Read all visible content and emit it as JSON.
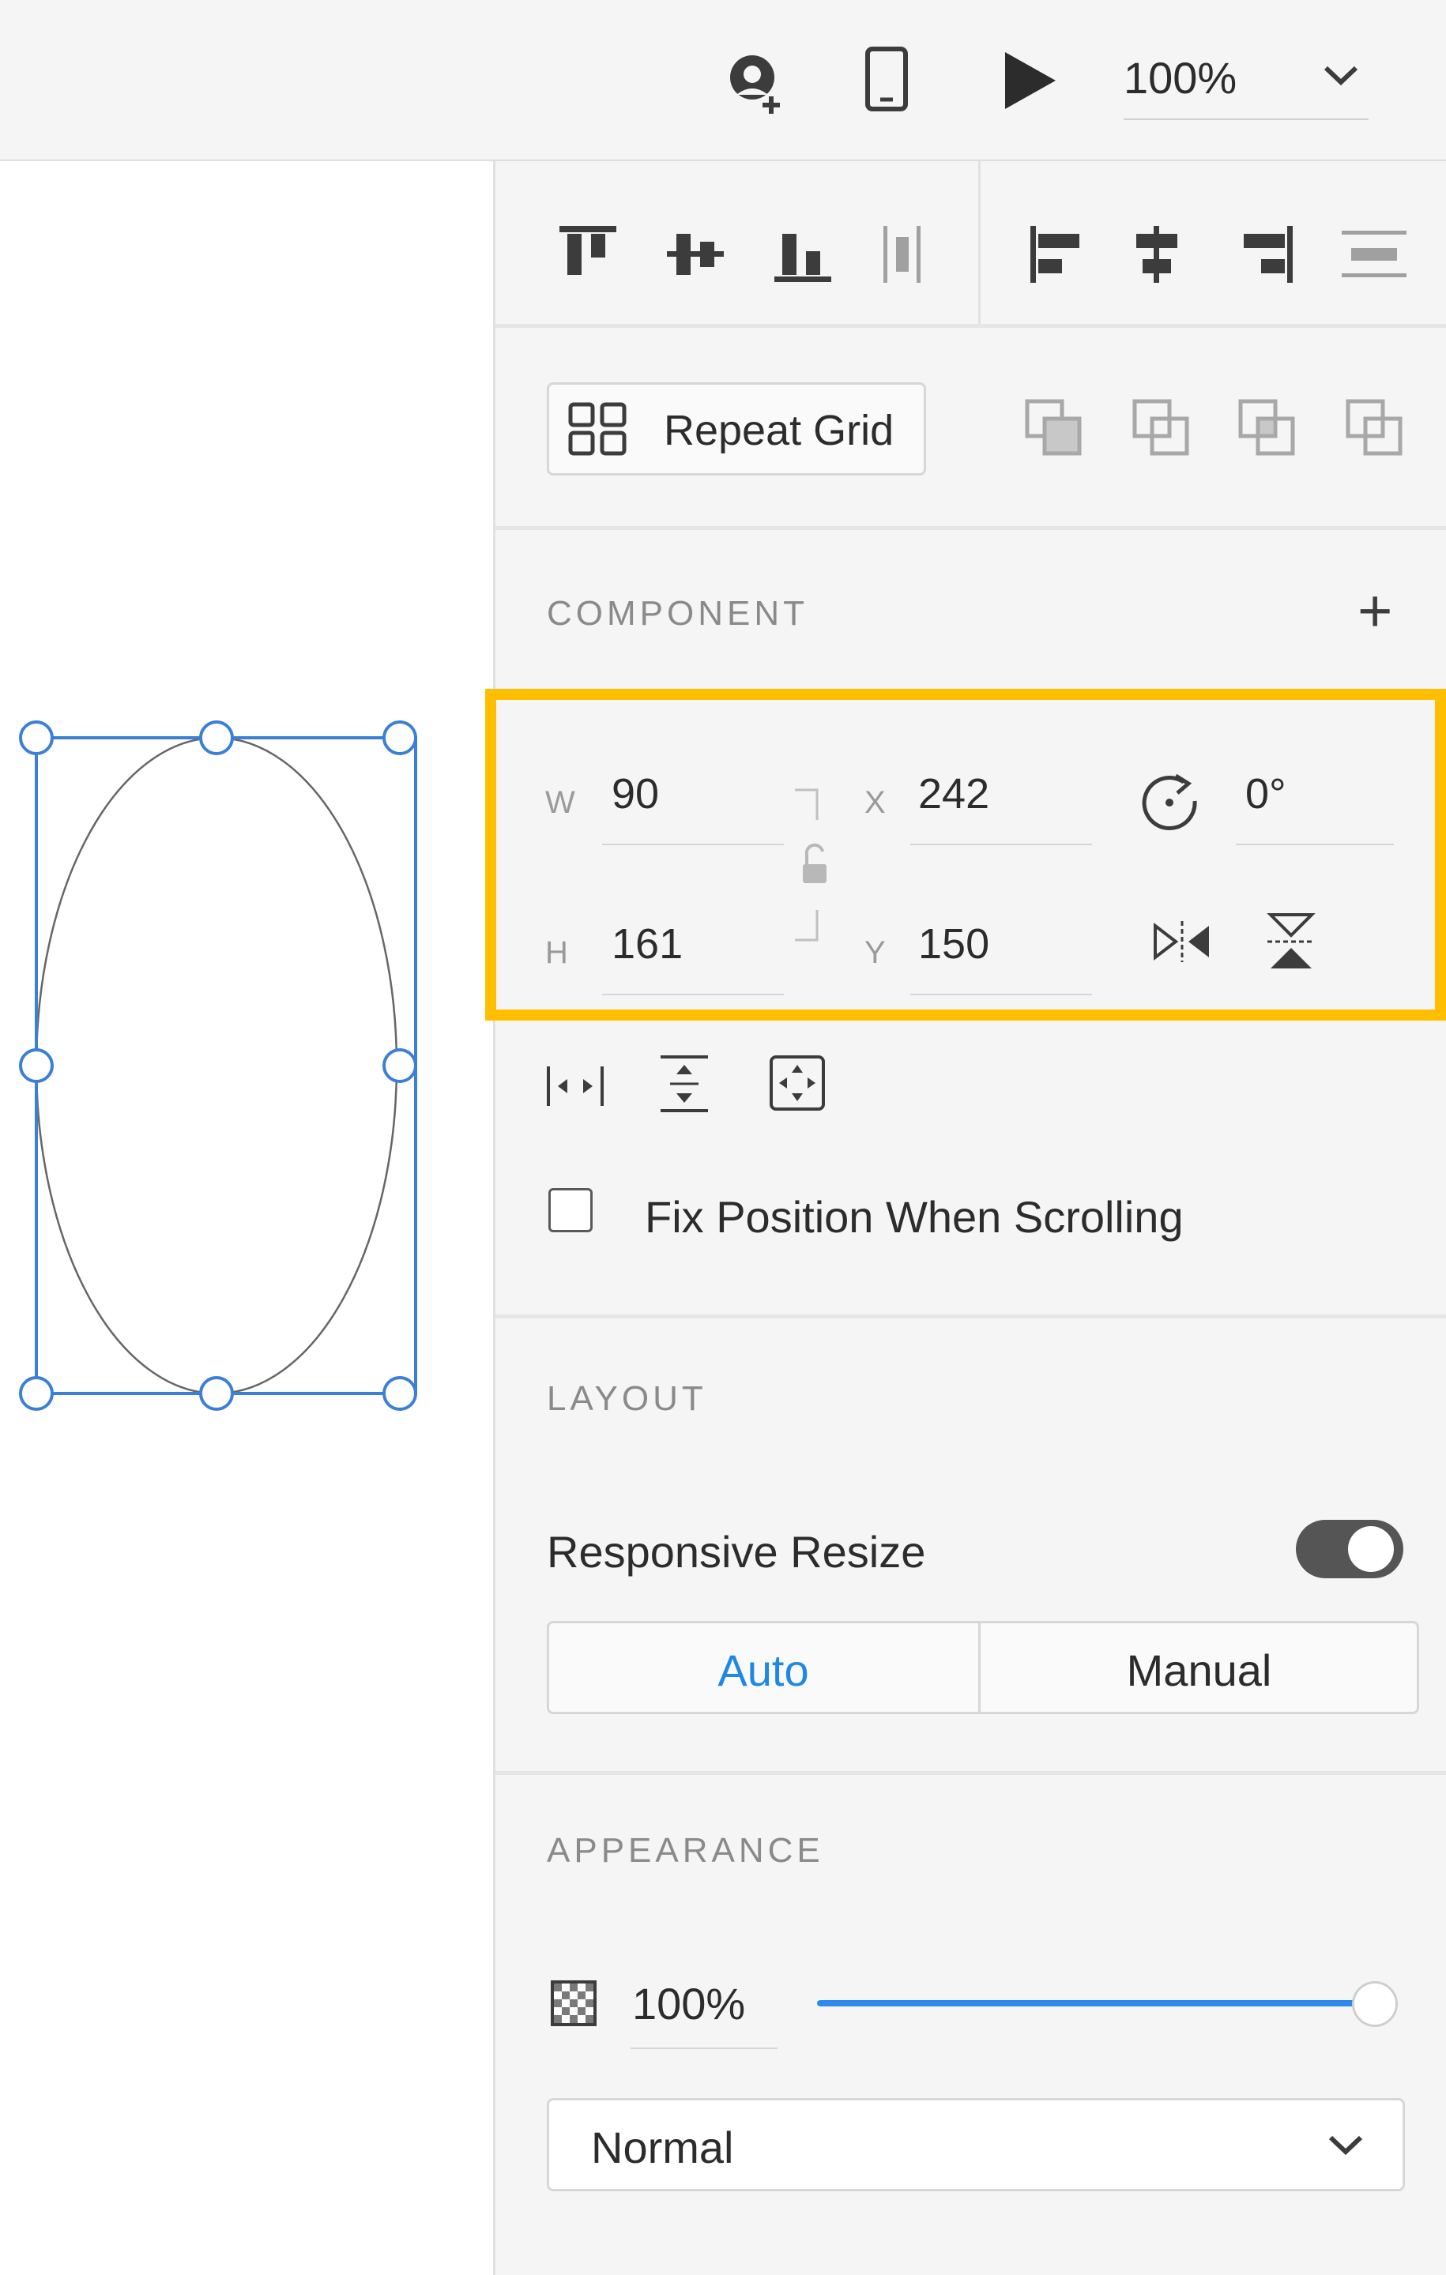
{
  "toolbar": {
    "zoom_value": "100%"
  },
  "align_bar": {
    "icons": [
      "align-top-icon",
      "align-middle-icon",
      "align-bottom-icon",
      "distribute-vertical-icon",
      "align-left-icon",
      "align-center-icon",
      "align-right-icon",
      "distribute-horizontal-icon"
    ]
  },
  "repeat_grid": {
    "label": "Repeat Grid"
  },
  "component": {
    "title": "COMPONENT",
    "add_symbol": "+"
  },
  "transform": {
    "w_label": "W",
    "w_value": "90",
    "h_label": "H",
    "h_value": "161",
    "x_label": "X",
    "x_value": "242",
    "y_label": "Y",
    "y_value": "150",
    "rotation_value": "0°"
  },
  "fix_position": {
    "label": "Fix Position When Scrolling",
    "checked": false
  },
  "layout": {
    "title": "LAYOUT",
    "responsive_resize_label": "Responsive Resize",
    "responsive_resize_on": true,
    "options": [
      "Auto",
      "Manual"
    ],
    "selected": "Auto"
  },
  "appearance": {
    "title": "APPEARANCE",
    "opacity_value": "100%",
    "opacity_level": 1.0,
    "blend_mode": "Normal"
  },
  "colors": {
    "accent": "#1f88e6",
    "highlight": "#ffbf00",
    "selection": "#3b7fd6"
  }
}
